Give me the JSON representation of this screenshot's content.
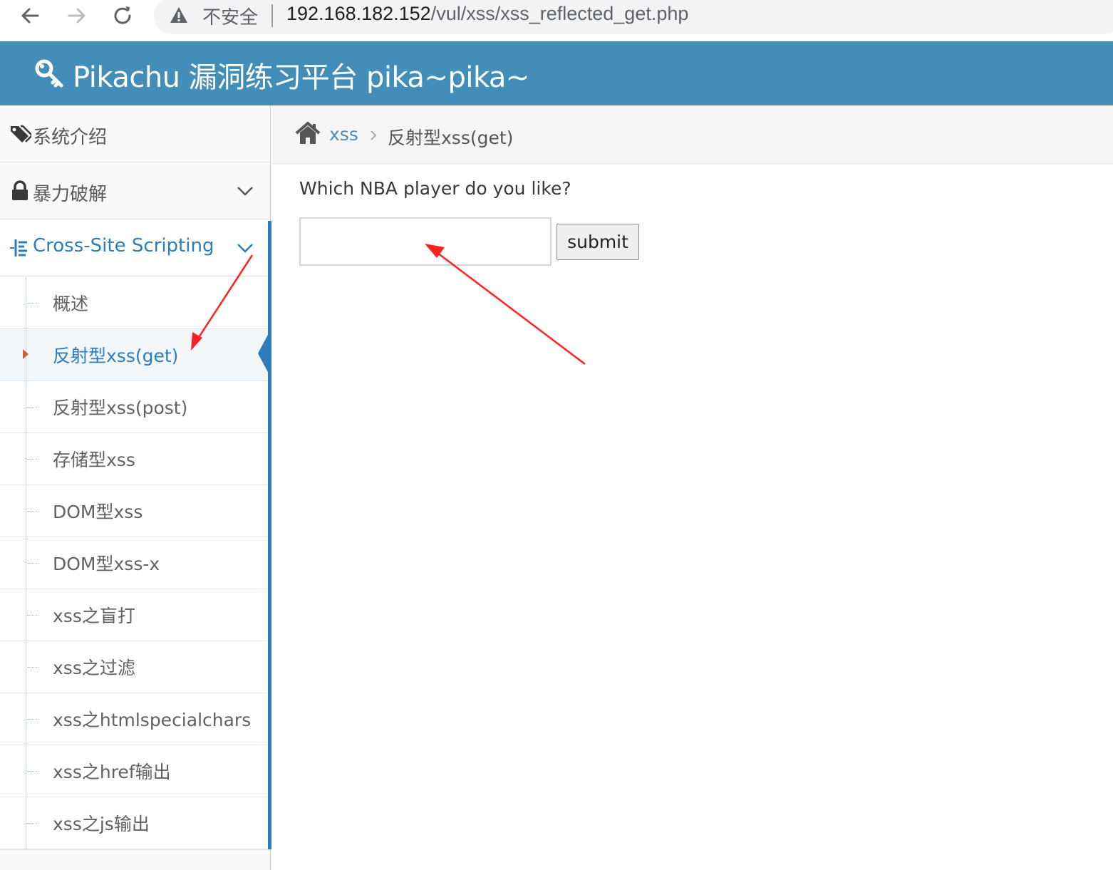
{
  "browser": {
    "security_label": "不安全",
    "url_host": "192.168.182.152",
    "url_path": "/vul/xss/xss_reflected_get.php"
  },
  "header": {
    "title": "Pikachu 漏洞练习平台 pika~pika~"
  },
  "sidebar": {
    "items": [
      {
        "label": "系统介绍",
        "icon": "tags-icon"
      },
      {
        "label": "暴力破解",
        "icon": "lock-icon"
      },
      {
        "label": "Cross-Site Scripting",
        "icon": "list-icon"
      }
    ],
    "xss_submenu": [
      {
        "label": "概述"
      },
      {
        "label": "反射型xss(get)",
        "active": true
      },
      {
        "label": "反射型xss(post)"
      },
      {
        "label": "存储型xss"
      },
      {
        "label": "DOM型xss"
      },
      {
        "label": "DOM型xss-x"
      },
      {
        "label": "xss之盲打"
      },
      {
        "label": "xss之过滤"
      },
      {
        "label": "xss之htmlspecialchars"
      },
      {
        "label": "xss之href输出"
      },
      {
        "label": "xss之js输出"
      }
    ]
  },
  "breadcrumb": {
    "link": "xss",
    "current": "反射型xss(get)"
  },
  "form": {
    "question": "Which NBA player do you like?",
    "input_value": "",
    "submit_label": "submit"
  },
  "colors": {
    "header_bg": "#438eb9",
    "accent_blue": "#2b7dbc",
    "annotation_red": "#ff2020"
  }
}
